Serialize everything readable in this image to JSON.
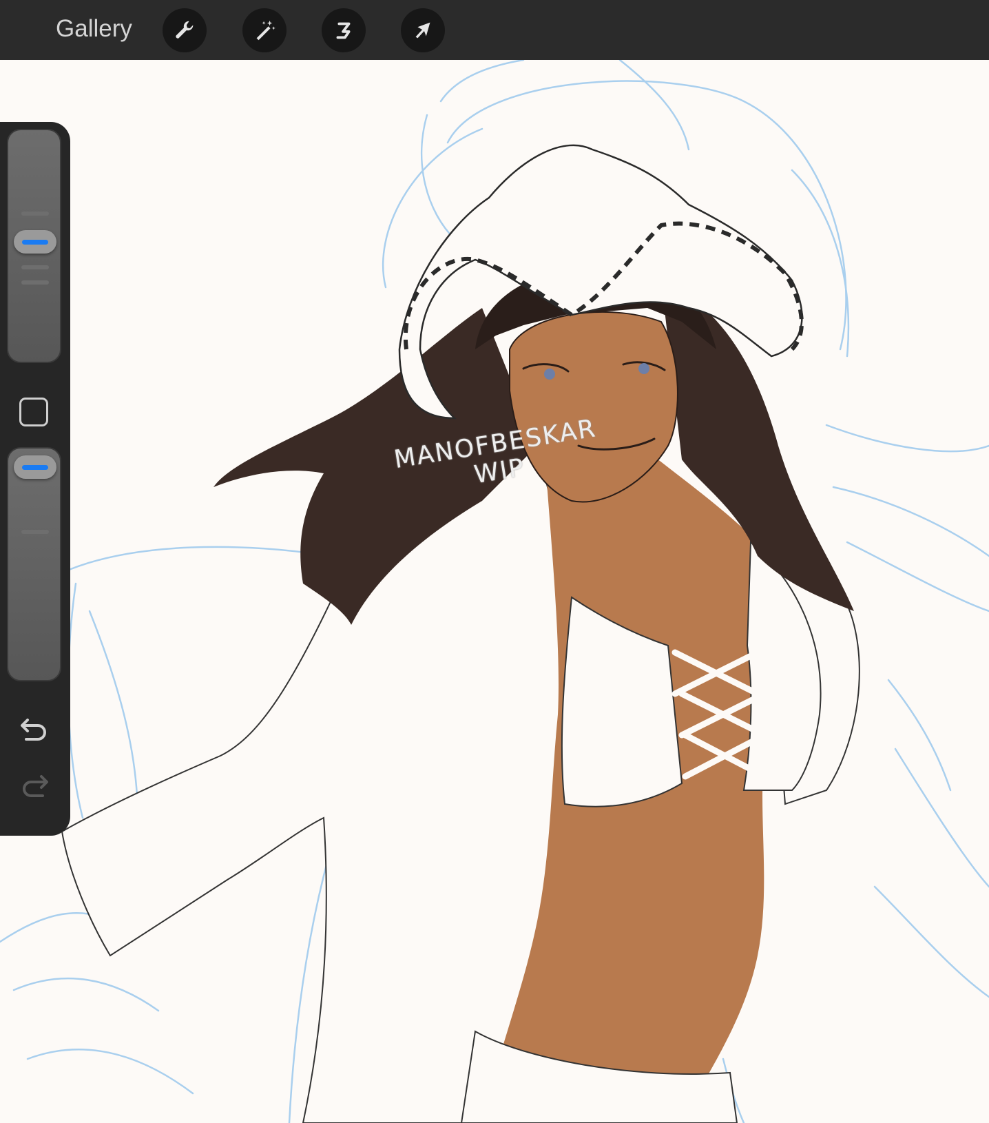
{
  "topbar": {
    "gallery_label": "Gallery",
    "tools": [
      {
        "name": "wrench-icon",
        "action": "actions"
      },
      {
        "name": "magic-wand-icon",
        "action": "adjustments"
      },
      {
        "name": "selection-icon",
        "action": "selection"
      },
      {
        "name": "arrow-cursor-icon",
        "action": "transform"
      }
    ]
  },
  "sidebar": {
    "brush_size_level": 0.52,
    "opacity_level": 0.0,
    "icons": [
      "modify-square-icon",
      "undo-icon",
      "redo-icon"
    ]
  },
  "canvas": {
    "watermark_line1": "MANOFBESKAR",
    "watermark_line2": "WIP"
  },
  "colors": {
    "toolbar_bg": "#2b2b2b",
    "sidebar_bg": "#262626",
    "accent": "#1a7bf2",
    "canvas_bg": "#fdfaf7",
    "sketch_blue": "#a9cfee",
    "skin": "#b87a4e",
    "hair": "#3a2a25"
  }
}
